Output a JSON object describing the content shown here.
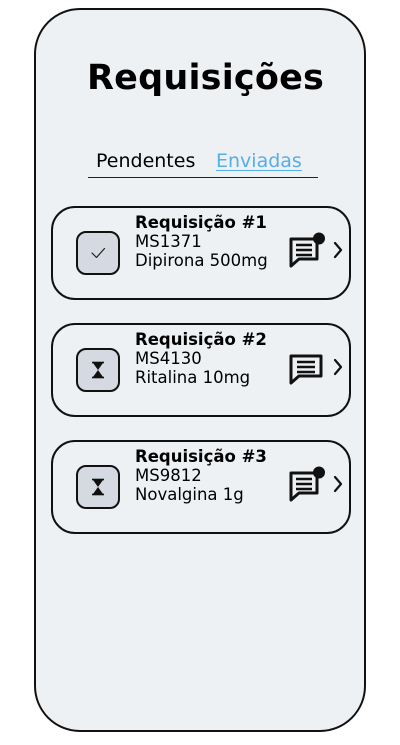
{
  "page": {
    "title": "Requisições"
  },
  "tabs": {
    "pending_label": "Pendentes",
    "sent_label": "Enviadas"
  },
  "requisitions": [
    {
      "title": "Requisição #1",
      "code": "MS1371",
      "medication": "Dipirona 500mg",
      "status_icon": "check-icon",
      "message_icon": "message-unread-icon",
      "has_unread_message": true
    },
    {
      "title": "Requisição #2",
      "code": "MS4130",
      "medication": "Ritalina 10mg",
      "status_icon": "hourglass-icon",
      "message_icon": "message-icon",
      "has_unread_message": false
    },
    {
      "title": "Requisição #3",
      "code": "MS9812",
      "medication": "Novalgina 1g",
      "status_icon": "hourglass-icon",
      "message_icon": "message-unread-icon",
      "has_unread_message": true
    }
  ],
  "colors": {
    "background": "#eef1f4",
    "status_box": "#d4d9e2",
    "link_active": "#56aee6",
    "border": "#111111"
  }
}
